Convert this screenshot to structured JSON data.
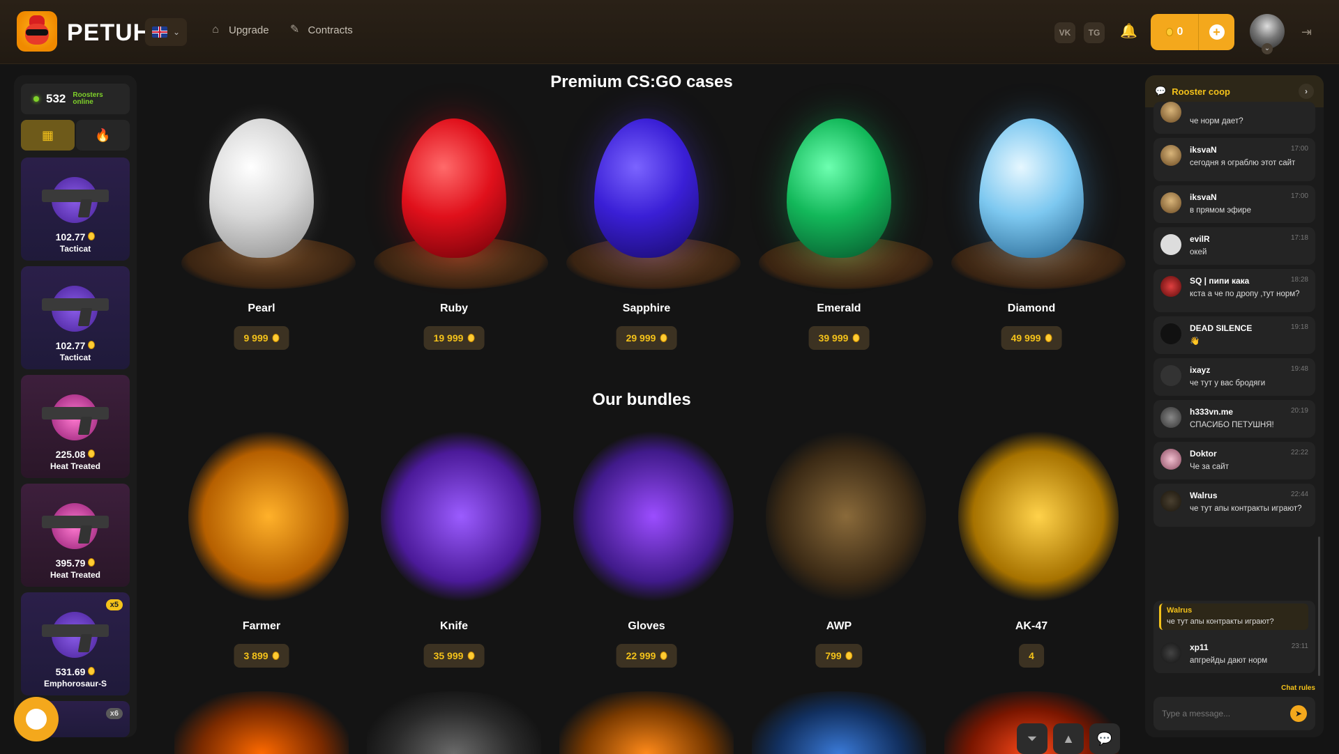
{
  "header": {
    "brand": "PETUH",
    "nav": [
      {
        "label": "Upgrade",
        "icon": "upgrade-icon"
      },
      {
        "label": "Contracts",
        "icon": "contracts-icon"
      }
    ],
    "social": [
      {
        "label": "VK",
        "icon": "vk-icon"
      },
      {
        "label": "TG",
        "icon": "telegram-icon"
      }
    ],
    "balance": "0"
  },
  "sidebar": {
    "online_count": "532",
    "online_label_1": "Roosters",
    "online_label_2": "online",
    "drops": [
      {
        "price": "102.77",
        "name": "Tacticat",
        "theme": "purple"
      },
      {
        "price": "102.77",
        "name": "Tacticat",
        "theme": "purple"
      },
      {
        "price": "225.08",
        "name": "Heat Treated",
        "theme": "pink"
      },
      {
        "price": "395.79",
        "name": "Heat Treated",
        "theme": "pink"
      },
      {
        "price": "531.69",
        "name": "Emphorosaur-S",
        "theme": "purple",
        "mult": "x5"
      },
      {
        "price": "",
        "name": "",
        "theme": "purple",
        "mult": "x6"
      }
    ]
  },
  "main": {
    "premium_title": "Premium CS:GO cases",
    "premium": [
      {
        "name": "Pearl",
        "price": "9 999"
      },
      {
        "name": "Ruby",
        "price": "19 999"
      },
      {
        "name": "Sapphire",
        "price": "29 999"
      },
      {
        "name": "Emerald",
        "price": "39 999"
      },
      {
        "name": "Diamond",
        "price": "49 999"
      }
    ],
    "bundles_title": "Our bundles",
    "bundles": [
      {
        "name": "Farmer",
        "price": "3 899"
      },
      {
        "name": "Knife",
        "price": "35 999"
      },
      {
        "name": "Gloves",
        "price": "22 999"
      },
      {
        "name": "AWP",
        "price": "799"
      },
      {
        "name": "AK-47",
        "price": "4"
      }
    ]
  },
  "chat": {
    "title": "Rooster coop",
    "messages": [
      {
        "user": "",
        "time": "",
        "text": "че норм дает?"
      },
      {
        "user": "iksvaN",
        "time": "17:00",
        "text": "сегодня я ограблю этот сайт"
      },
      {
        "user": "iksvaN",
        "time": "17:00",
        "text": "в прямом эфире"
      },
      {
        "user": "evilR",
        "time": "17:18",
        "text": "окей"
      },
      {
        "user": "SQ | пипи кака",
        "time": "18:28",
        "text": "кста а че по дропу ,тут норм?"
      },
      {
        "user": "DEAD SILENCE",
        "time": "19:18",
        "text": "👋"
      },
      {
        "user": "ixayz",
        "time": "19:48",
        "text": "че тут у вас бродяги"
      },
      {
        "user": "h333vn.me",
        "time": "20:19",
        "text": "СПАСИБО ПЕТУШНЯ!"
      },
      {
        "user": "Doktor",
        "time": "22:22",
        "text": "Че за сайт"
      },
      {
        "user": "Walrus",
        "time": "22:44",
        "text": "че тут апы контракты играют?"
      },
      {
        "user": "xp11",
        "time": "23:11",
        "text": "апгрейды дают норм"
      }
    ],
    "reply_user": "Walrus",
    "reply_text": "че тут апы контракты играют?",
    "rules": "Chat rules",
    "placeholder": "Type a message..."
  }
}
